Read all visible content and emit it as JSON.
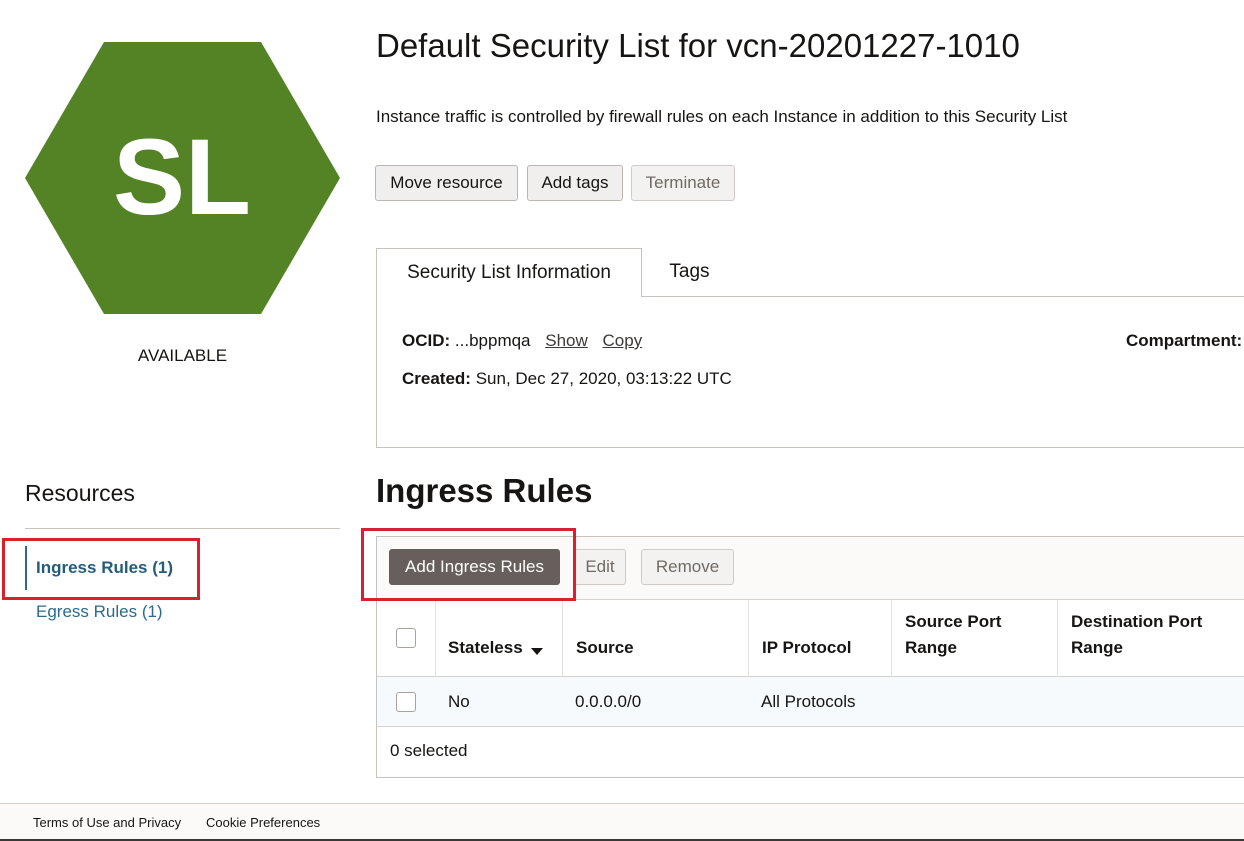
{
  "resource": {
    "icon_text": "SL",
    "icon_color": "#548325",
    "status": "AVAILABLE"
  },
  "page": {
    "title": "Default Security List for vcn-20201227-1010",
    "description": "Instance traffic is controlled by firewall rules on each Instance in addition to this Security List"
  },
  "actions": {
    "move": "Move resource",
    "tags": "Add tags",
    "terminate": "Terminate"
  },
  "tabs": {
    "info": "Security List Information",
    "tags": "Tags"
  },
  "info": {
    "ocid_label": "OCID:",
    "ocid_value": "...bppmqa",
    "show": "Show",
    "copy": "Copy",
    "compartment_label": "Compartment:",
    "created_label": "Created:",
    "created_value": "Sun, Dec 27, 2020, 03:13:22 UTC"
  },
  "resources": {
    "heading": "Resources",
    "items": [
      {
        "label": "Ingress Rules (1)"
      },
      {
        "label": "Egress Rules (1)"
      }
    ]
  },
  "ingress": {
    "heading": "Ingress Rules",
    "add": "Add Ingress Rules",
    "edit": "Edit",
    "remove": "Remove",
    "columns": {
      "stateless": "Stateless",
      "source": "Source",
      "protocol": "IP Protocol",
      "src_port_1": "Source Port",
      "src_port_2": "Range",
      "dst_port_1": "Destination Port",
      "dst_port_2": "Range"
    },
    "rows": [
      {
        "stateless": "No",
        "source": "0.0.0.0/0",
        "protocol": "All Protocols"
      }
    ],
    "selected": "0 selected"
  },
  "footer": {
    "terms": "Terms of Use and Privacy",
    "cookies": "Cookie Preferences"
  }
}
